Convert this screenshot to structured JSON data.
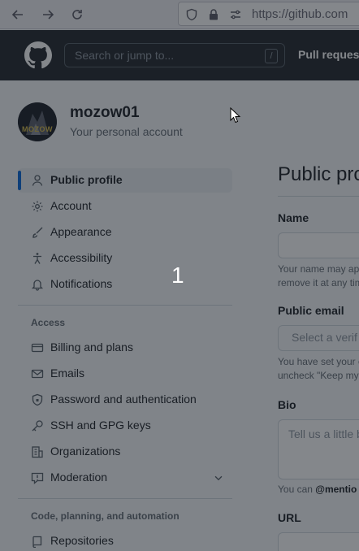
{
  "browser": {
    "url": "https://github.com",
    "back_icon": "arrow-left-icon",
    "forward_icon": "arrow-right-icon",
    "reload_icon": "reload-icon"
  },
  "header": {
    "search_placeholder": "Search or jump to...",
    "slash_hint": "/",
    "pull_requests": "Pull reques"
  },
  "account": {
    "username": "mozow01",
    "subtitle": "Your personal account",
    "avatar_text": "MOZOW"
  },
  "sidebar": {
    "items_top": [
      {
        "label": "Public profile",
        "icon": "person-icon",
        "active": true
      },
      {
        "label": "Account",
        "icon": "gear-icon"
      },
      {
        "label": "Appearance",
        "icon": "paintbrush-icon"
      },
      {
        "label": "Accessibility",
        "icon": "accessibility-icon"
      },
      {
        "label": "Notifications",
        "icon": "bell-icon"
      }
    ],
    "access_heading": "Access",
    "items_access": [
      {
        "label": "Billing and plans",
        "icon": "credit-card-icon"
      },
      {
        "label": "Emails",
        "icon": "mail-icon"
      },
      {
        "label": "Password and authentication",
        "icon": "shield-lock-icon"
      },
      {
        "label": "SSH and GPG keys",
        "icon": "key-icon"
      },
      {
        "label": "Organizations",
        "icon": "organization-icon"
      },
      {
        "label": "Moderation",
        "icon": "report-icon"
      }
    ],
    "code_heading": "Code, planning, and automation",
    "items_code": [
      {
        "label": "Repositories",
        "icon": "repo-icon"
      }
    ]
  },
  "main": {
    "title": "Public pro",
    "name_label": "Name",
    "name_note_1": "Your name may ap",
    "name_note_2": "remove it at any tim",
    "email_label": "Public email",
    "email_placeholder": "Select a verif",
    "email_note_1": "You have set your e",
    "email_note_2": "uncheck \"Keep my",
    "bio_label": "Bio",
    "bio_placeholder": "Tell us a little b",
    "bio_note_prefix": "You can ",
    "bio_note_bold": "@mentio",
    "url_label": "URL"
  },
  "overlay": {
    "number": "1"
  },
  "colors": {
    "header_bg": "#24292f",
    "accent": "#0969da",
    "overlay": "rgba(20,24,32,0.52)"
  }
}
